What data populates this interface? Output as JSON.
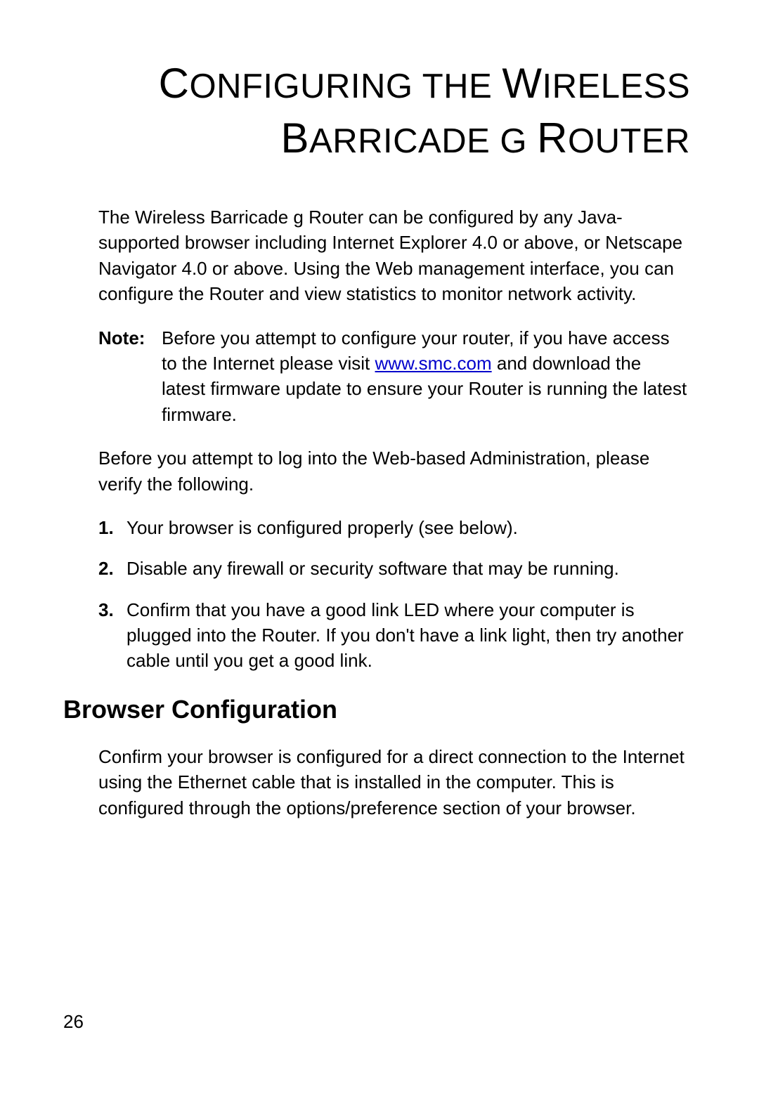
{
  "title": {
    "w1_cap": "C",
    "w1_rest": "ONFIGURING",
    "w2_rest": "THE",
    "w3_cap": "W",
    "w3_rest": "IRELESS",
    "w4_cap": "B",
    "w4_rest": "ARRICADE",
    "w5_rest": "G",
    "w6_cap": "R",
    "w6_rest": "OUTER"
  },
  "intro": "The Wireless Barricade g Router can be configured by any Java-supported browser including Internet Explorer 4.0 or above, or Netscape Navigator 4.0 or above. Using the Web management interface, you can configure the Router and view statistics to monitor network activity.",
  "note": {
    "label": "Note:",
    "before_link": "Before you attempt to configure your router, if you have access to the Internet please visit ",
    "link_text": "www.smc.com",
    "after_link": " and download the latest firmware update to ensure your Router is running the latest firmware."
  },
  "pre_list": "Before you attempt to log into the Web-based Administration, please verify the following.",
  "list": [
    {
      "num": "1.",
      "text": "Your browser is configured properly (see below)."
    },
    {
      "num": "2.",
      "text": "Disable any firewall or security software that may be running."
    },
    {
      "num": "3.",
      "text": "Confirm that you have a good link LED where your computer is plugged into the Router. If you don't have a link light, then try another cable until you get a good link."
    }
  ],
  "section_heading": "Browser Configuration",
  "section_body": "Confirm your browser is configured for a direct connection to the Internet using the Ethernet cable that is installed in the computer. This is configured through the options/preference section of your browser.",
  "page_number": "26"
}
